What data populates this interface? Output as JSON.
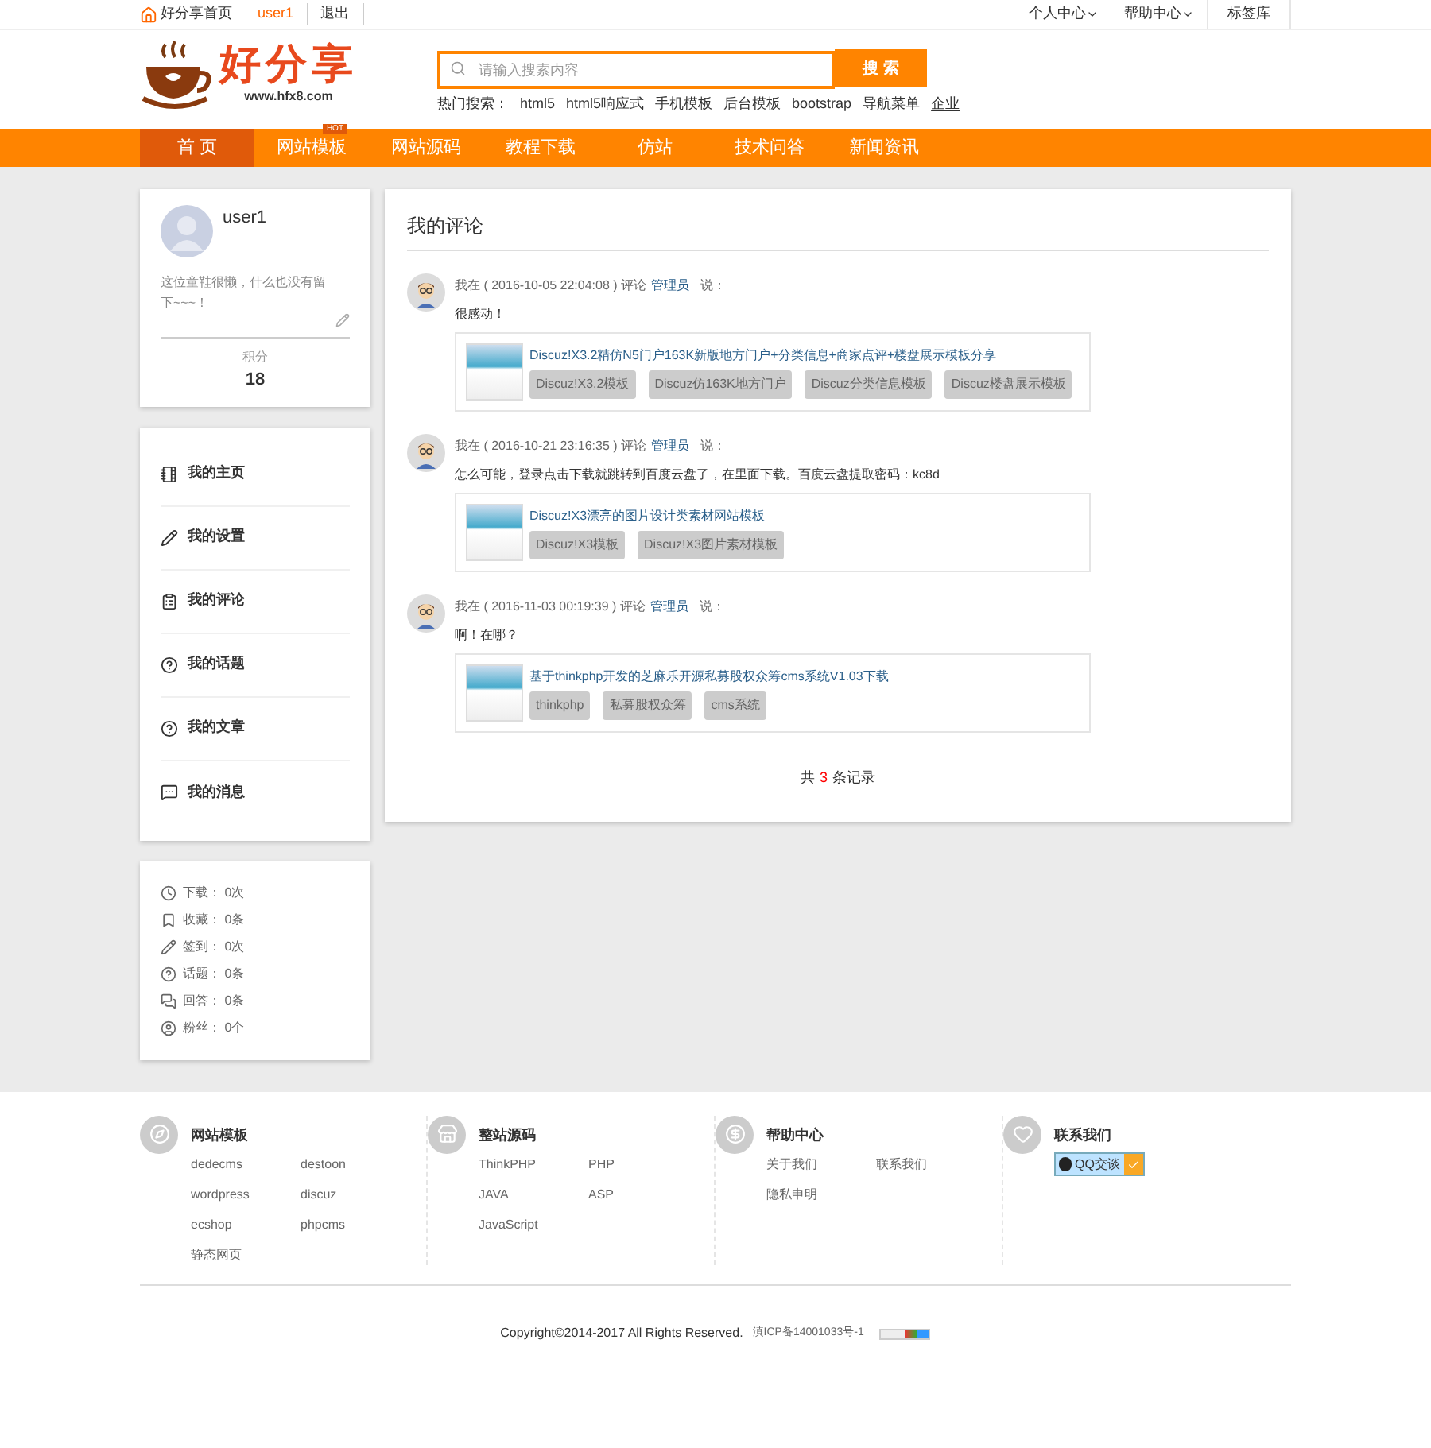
{
  "topbar": {
    "home": "好分享首页",
    "user": "user1",
    "logout": "退出",
    "menus": [
      {
        "label": "个人中心",
        "kind": "dropdown"
      },
      {
        "label": "帮助中心",
        "kind": "dropdown"
      },
      {
        "label": "标签库",
        "kind": "plain"
      }
    ]
  },
  "logo": {
    "title": "好分享",
    "url": "www.hfx8.com"
  },
  "search": {
    "placeholder": "请输入搜索内容",
    "button": "搜 索",
    "hot_label": "热门搜索：",
    "hot": [
      "html5",
      "html5响应式",
      "手机模板",
      "后台模板",
      "bootstrap",
      "导航菜单",
      "企业"
    ]
  },
  "nav": [
    {
      "label": "首 页",
      "selected": true
    },
    {
      "label": "网站模板",
      "selected": false,
      "badge": "HOT"
    },
    {
      "label": "网站源码",
      "selected": false
    },
    {
      "label": "教程下载",
      "selected": false
    },
    {
      "label": "仿站",
      "selected": false
    },
    {
      "label": "技术问答",
      "selected": false
    },
    {
      "label": "新闻资讯",
      "selected": false
    }
  ],
  "profile": {
    "name": "user1",
    "bio": "这位童鞋很懒，什么也没有留下~~~！",
    "score_label": "积分",
    "score": "18"
  },
  "menu": [
    "我的主页",
    "我的设置",
    "我的评论",
    "我的话题",
    "我的文章",
    "我的消息"
  ],
  "stats": [
    "下载： 0次",
    "收藏： 0条",
    "签到： 0次",
    "话题： 0条",
    "回答： 0条",
    "粉丝： 0个"
  ],
  "comments": {
    "title": "我的评论",
    "items": [
      {
        "meta": "我在 ( 2016-10-05 22:04:08 ) 评论",
        "author": "管理员",
        "said": "说：",
        "text": "很感动！",
        "resource": {
          "title": "Discuz!X3.2精仿N5门户163K新版地方门户+分类信息+商家点评+楼盘展示模板分享",
          "tags": [
            "Discuz!X3.2模板",
            "Discuz仿163K地方门户",
            "Discuz分类信息模板",
            "Discuz楼盘展示模板"
          ]
        }
      },
      {
        "meta": "我在 ( 2016-10-21 23:16:35 ) 评论",
        "author": "管理员",
        "said": "说：",
        "text": "怎么可能，登录点击下载就跳转到百度云盘了，在里面下载。百度云盘提取密码：kc8d",
        "resource": {
          "title": "Discuz!X3漂亮的图片设计类素材网站模板",
          "tags": [
            "Discuz!X3模板",
            "Discuz!X3图片素材模板"
          ]
        }
      },
      {
        "meta": "我在 ( 2016-11-03 00:19:39 ) 评论",
        "author": "管理员",
        "said": "说：",
        "text": "啊！在哪？",
        "resource": {
          "title": "基于thinkphp开发的芝麻乐开源私募股权众筹cms系统V1.03下载",
          "tags": [
            "thinkphp",
            "私募股权众筹",
            "cms系统"
          ]
        }
      }
    ],
    "total_prefix": "共",
    "total_count": "3",
    "total_suffix": "条记录"
  },
  "footer": {
    "columns": [
      {
        "title": "网站模板",
        "links": [
          "dedecms",
          "destoon",
          "wordpress",
          "discuz",
          "ecshop",
          "phpcms",
          "静态网页"
        ]
      },
      {
        "title": "整站源码",
        "links": [
          "ThinkPHP",
          "PHP",
          "JAVA",
          "ASP",
          "JavaScript"
        ]
      },
      {
        "title": "帮助中心",
        "links": [
          "关于我们",
          "联系我们",
          "隐私申明"
        ]
      },
      {
        "title": "联系我们",
        "qq": "QQ交谈"
      }
    ],
    "copyright": "Copyright©2014-2017 All Rights Reserved.",
    "icp": "滇ICP备14001033号-1"
  }
}
